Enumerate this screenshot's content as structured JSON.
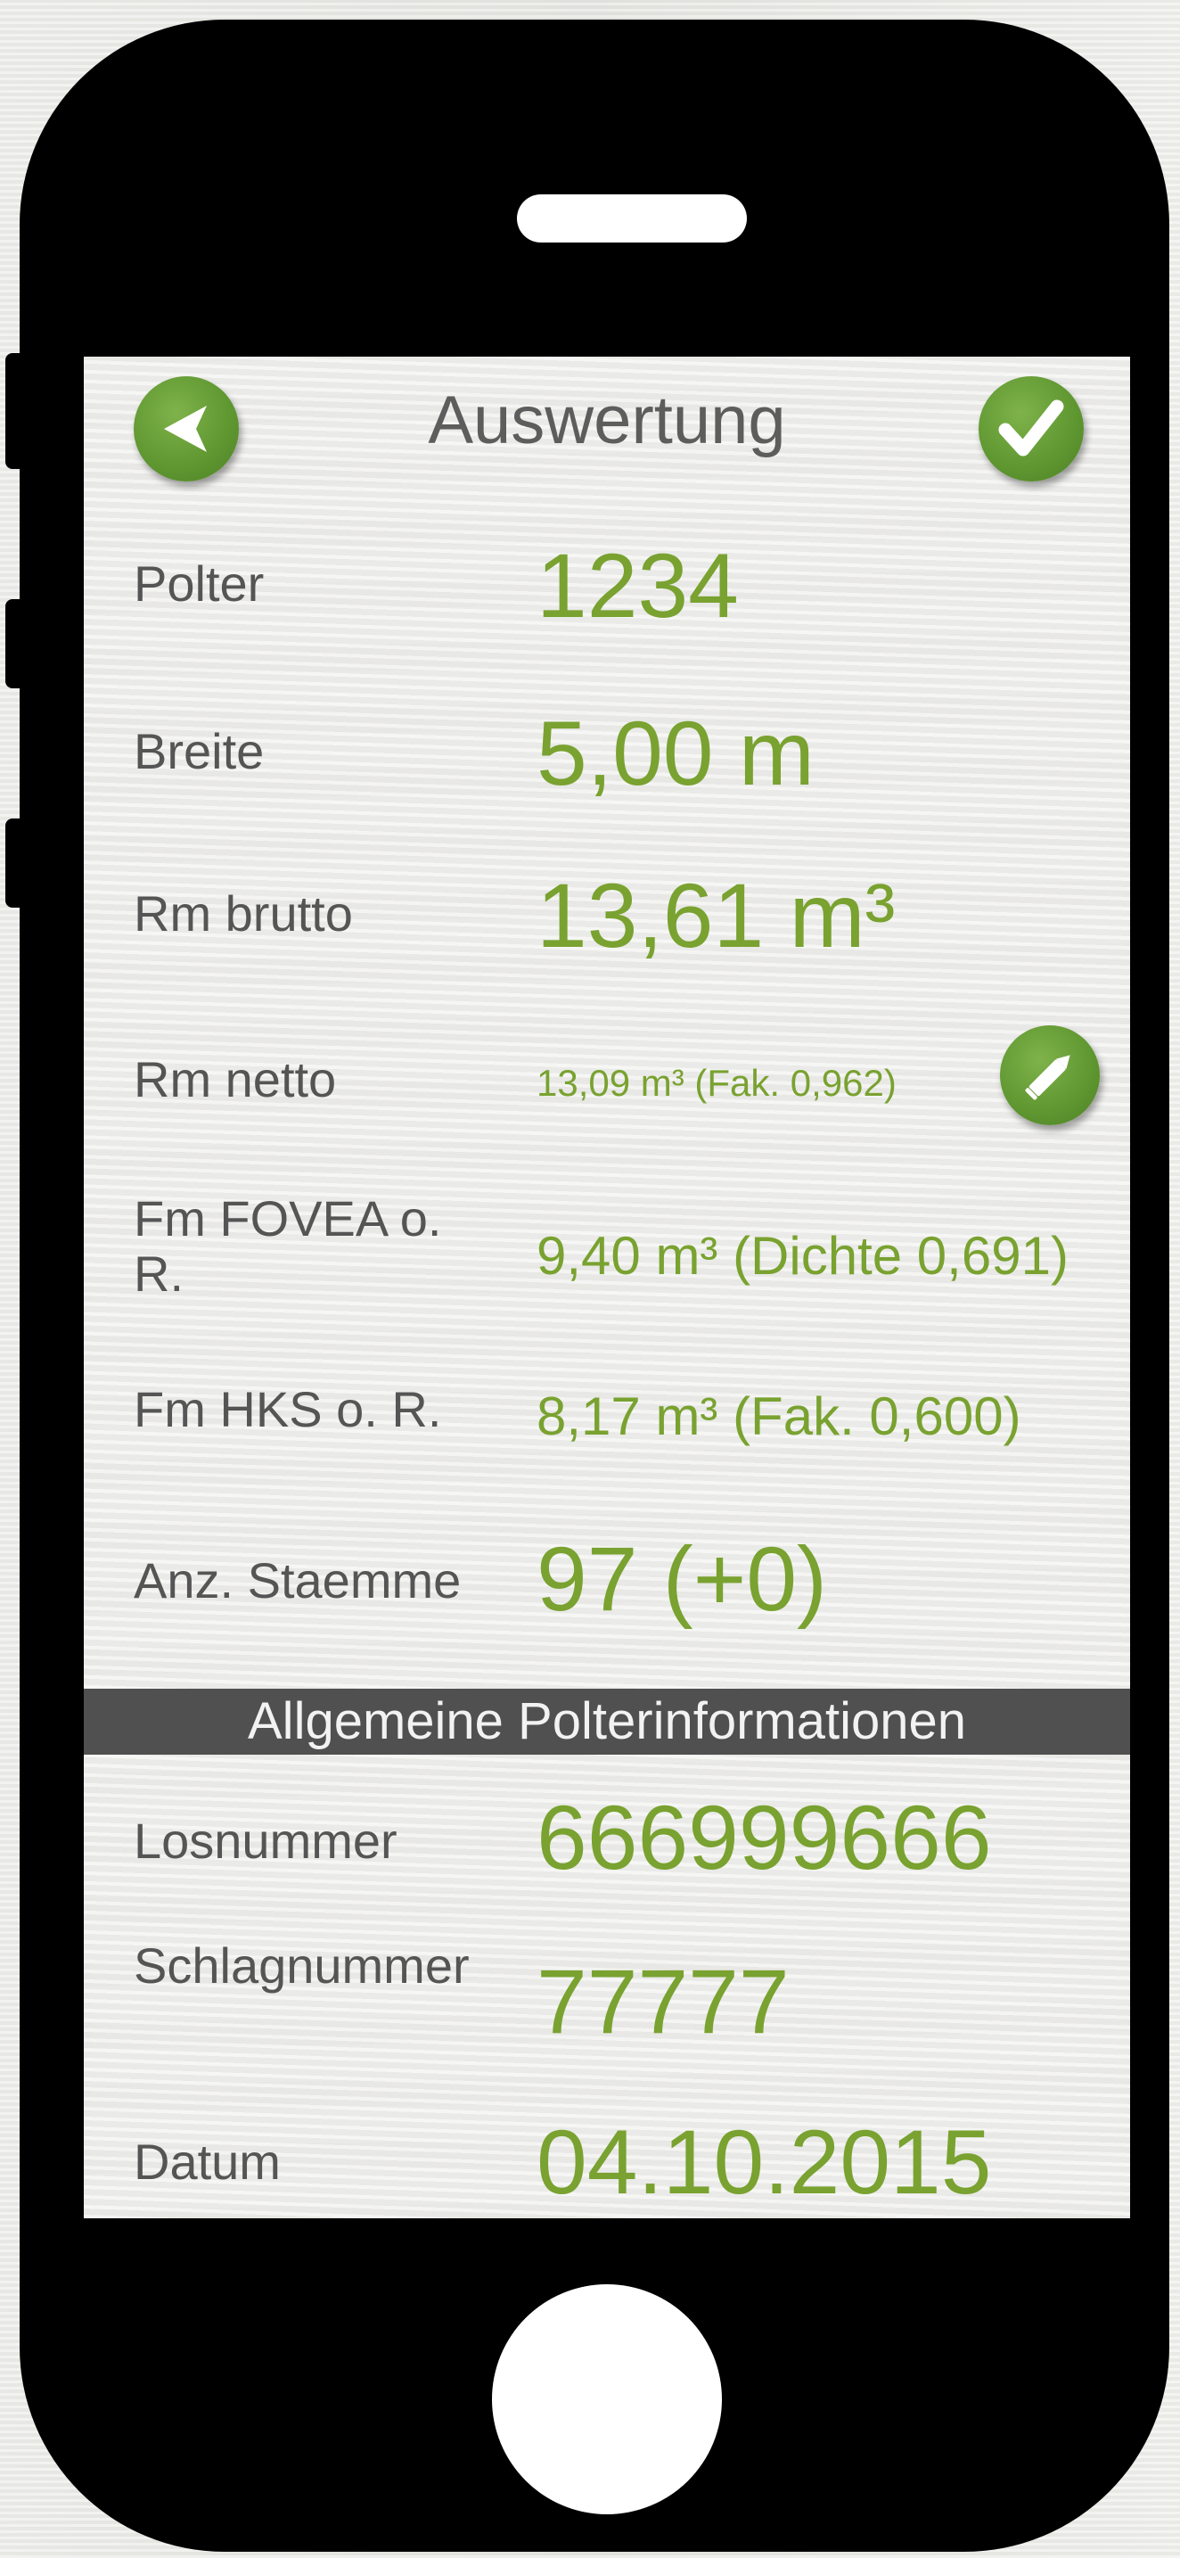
{
  "header": {
    "title": "Auswertung",
    "back_icon": "back-arrow-icon",
    "confirm_icon": "checkmark-icon"
  },
  "measurements": [
    {
      "label": "Polter",
      "value": "1234"
    },
    {
      "label": "Breite",
      "value": "5,00 m"
    },
    {
      "label": "Rm brutto",
      "value": "13,61 m³"
    },
    {
      "label": "Rm netto",
      "value": "13,09 m³ (Fak. 0,962)",
      "edit_icon": "pencil-icon"
    },
    {
      "label": "Fm FOVEA o. R.",
      "value": "9,40 m³ (Dichte 0,691)"
    },
    {
      "label": "Fm HKS o. R.",
      "value": "8,17 m³ (Fak. 0,600)"
    },
    {
      "label": "Anz. Staemme",
      "value": "97 (+0)"
    }
  ],
  "section": {
    "title": "Allgemeine Polterinformationen"
  },
  "info": [
    {
      "label": "Losnummer",
      "value": "666999666"
    },
    {
      "label": "Schlagnummer",
      "value": "77777"
    },
    {
      "label": "Datum",
      "value": "04.10.2015"
    }
  ],
  "colors": {
    "accent_green": "#79a230",
    "button_green": "#5e9630",
    "label_gray": "#555555",
    "section_bar": "#505050",
    "device_frame": "#000000"
  }
}
